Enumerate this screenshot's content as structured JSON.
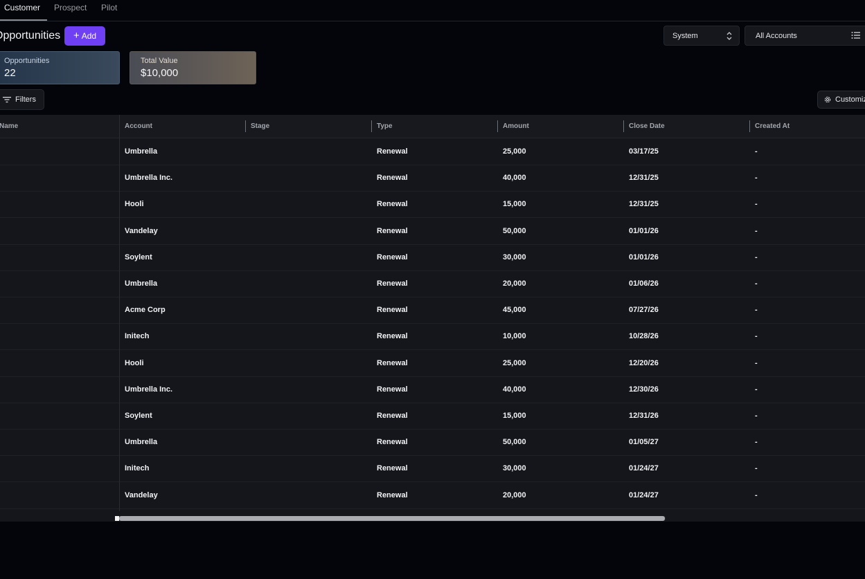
{
  "tabs": [
    {
      "label": "Customer",
      "active": true
    },
    {
      "label": "Prospect",
      "active": false
    },
    {
      "label": "Pilot",
      "active": false
    }
  ],
  "header": {
    "title": "Opportunities",
    "add_label": "Add",
    "system_select": "System",
    "accounts_select": "All Accounts"
  },
  "stats": {
    "opportunities_label": "Opportunities",
    "opportunities_value": "22",
    "total_value_label": "Total Value",
    "total_value_value": "$10,000"
  },
  "toolbar": {
    "filters_label": "Filters",
    "customize_label": "Customize"
  },
  "table": {
    "columns": [
      "Name",
      "Account",
      "Stage",
      "Type",
      "Amount",
      "Close Date",
      "Created At"
    ],
    "rows": [
      {
        "name": "",
        "account": "Umbrella",
        "stage": "",
        "type": "Renewal",
        "amount": "25,000",
        "close_date": "03/17/25",
        "created_at": "-"
      },
      {
        "name": "",
        "account": "Umbrella Inc.",
        "stage": "",
        "type": "Renewal",
        "amount": "40,000",
        "close_date": "12/31/25",
        "created_at": "-"
      },
      {
        "name": "",
        "account": "Hooli",
        "stage": "",
        "type": "Renewal",
        "amount": "15,000",
        "close_date": "12/31/25",
        "created_at": "-"
      },
      {
        "name": "",
        "account": "Vandelay",
        "stage": "",
        "type": "Renewal",
        "amount": "50,000",
        "close_date": "01/01/26",
        "created_at": "-"
      },
      {
        "name": "",
        "account": "Soylent",
        "stage": "",
        "type": "Renewal",
        "amount": "30,000",
        "close_date": "01/01/26",
        "created_at": "-"
      },
      {
        "name": "",
        "account": "Umbrella",
        "stage": "",
        "type": "Renewal",
        "amount": "20,000",
        "close_date": "01/06/26",
        "created_at": "-"
      },
      {
        "name": "",
        "account": "Acme Corp",
        "stage": "",
        "type": "Renewal",
        "amount": "45,000",
        "close_date": "07/27/26",
        "created_at": "-"
      },
      {
        "name": "",
        "account": "Initech",
        "stage": "",
        "type": "Renewal",
        "amount": "10,000",
        "close_date": "10/28/26",
        "created_at": "-"
      },
      {
        "name": "",
        "account": "Hooli",
        "stage": "",
        "type": "Renewal",
        "amount": "25,000",
        "close_date": "12/20/26",
        "created_at": "-"
      },
      {
        "name": "",
        "account": "Umbrella Inc.",
        "stage": "",
        "type": "Renewal",
        "amount": "40,000",
        "close_date": "12/30/26",
        "created_at": "-"
      },
      {
        "name": "",
        "account": "Soylent",
        "stage": "",
        "type": "Renewal",
        "amount": "15,000",
        "close_date": "12/31/26",
        "created_at": "-"
      },
      {
        "name": "",
        "account": "Umbrella",
        "stage": "",
        "type": "Renewal",
        "amount": "50,000",
        "close_date": "01/05/27",
        "created_at": "-"
      },
      {
        "name": "",
        "account": "Initech",
        "stage": "",
        "type": "Renewal",
        "amount": "30,000",
        "close_date": "01/24/27",
        "created_at": "-"
      },
      {
        "name": "",
        "account": "Vandelay",
        "stage": "",
        "type": "Renewal",
        "amount": "20,000",
        "close_date": "01/24/27",
        "created_at": "-"
      }
    ]
  },
  "colors": {
    "accent": "#6e3ff3",
    "background": "#04050a",
    "table_bg": "#14161b"
  },
  "icons": {
    "add": "plus-icon",
    "system": "chevron-up-down-icon",
    "accounts": "list-icon",
    "filters": "filter-icon",
    "customize": "gear-icon"
  }
}
